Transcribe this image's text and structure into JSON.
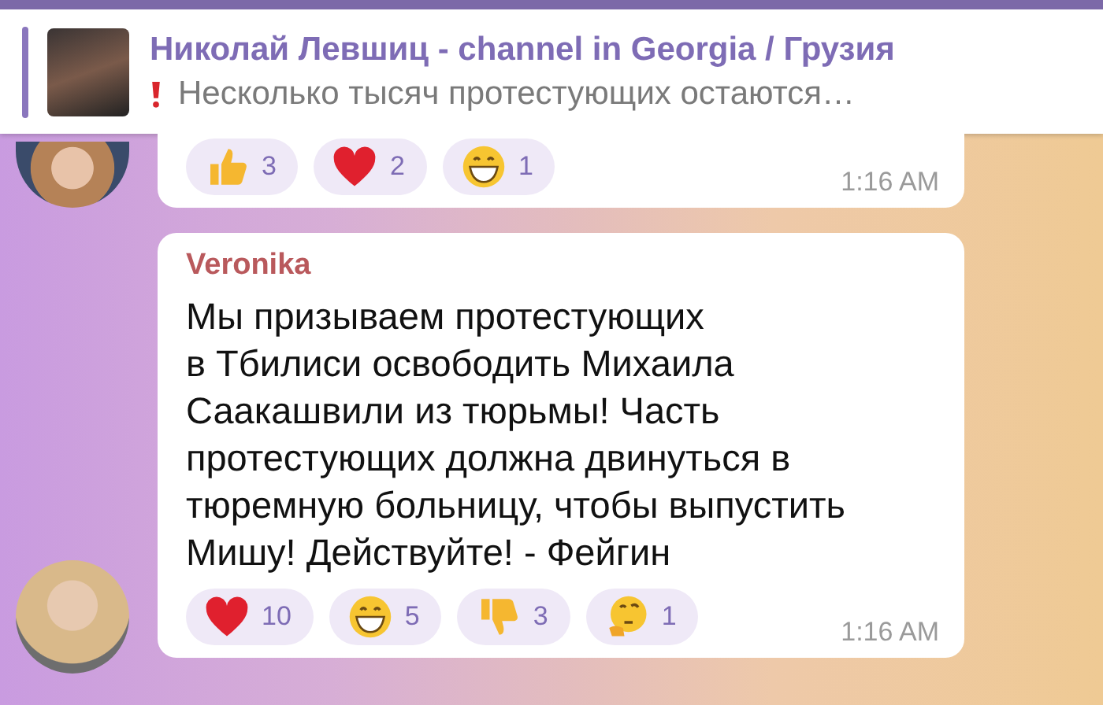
{
  "pinned": {
    "title": "Николай Левшиц - channel in Georgia / Грузия",
    "text": "Несколько тысяч протестующих остаются…"
  },
  "messages": [
    {
      "time": "1:16 AM",
      "reactions": [
        {
          "kind": "thumbs_up",
          "count": "3"
        },
        {
          "kind": "heart",
          "count": "2"
        },
        {
          "kind": "grin",
          "count": "1"
        }
      ]
    },
    {
      "author": "Veronika",
      "text": "Мы призываем протестующих\nв Тбилиси освободить Михаила\nСаакашвили из тюрьмы! Часть\nпротестующих должна двинуться в\nтюремную больницу, чтобы выпустить\nМишу! Действуйте! - Фейгин",
      "time": "1:16 AM",
      "reactions": [
        {
          "kind": "heart",
          "count": "10"
        },
        {
          "kind": "grin",
          "count": "5"
        },
        {
          "kind": "thumbs_down",
          "count": "3"
        },
        {
          "kind": "thinking",
          "count": "1"
        }
      ]
    }
  ]
}
